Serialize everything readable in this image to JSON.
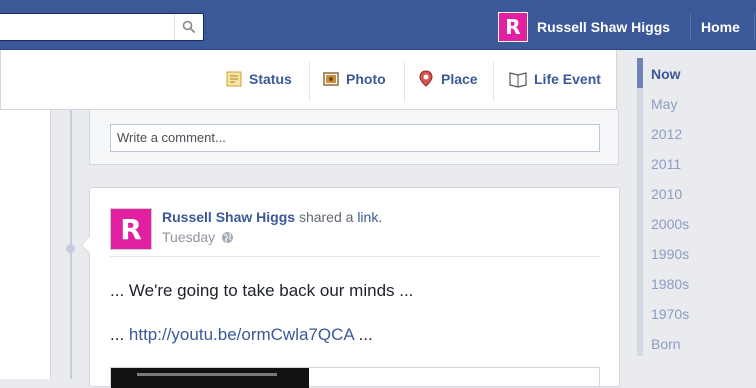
{
  "header": {
    "user_name": "Russell Shaw Higgs",
    "home_label": "Home",
    "avatar_letter": "R"
  },
  "composer": {
    "items": [
      {
        "label": "Status",
        "icon": "status-icon"
      },
      {
        "label": "Photo",
        "icon": "photo-icon"
      },
      {
        "label": "Place",
        "icon": "place-icon"
      },
      {
        "label": "Life Event",
        "icon": "life-event-icon"
      }
    ]
  },
  "comment": {
    "placeholder": "Write a comment..."
  },
  "post": {
    "author": "Russell Shaw Higgs",
    "action_pre": "shared a",
    "action_link": "link.",
    "time": "Tuesday",
    "text_line1": "... We're going to take back our minds ...",
    "text_pre": "...",
    "url": "http://youtu.be/ormCwla7QCA",
    "text_post": "..."
  },
  "timeline_nav": {
    "items": [
      "Now",
      "May",
      "2012",
      "2011",
      "2010",
      "2000s",
      "1990s",
      "1980s",
      "1970s",
      "Born"
    ],
    "active": "Now"
  },
  "colors": {
    "brand": "#3b5998",
    "avatar": "#e020a0"
  }
}
